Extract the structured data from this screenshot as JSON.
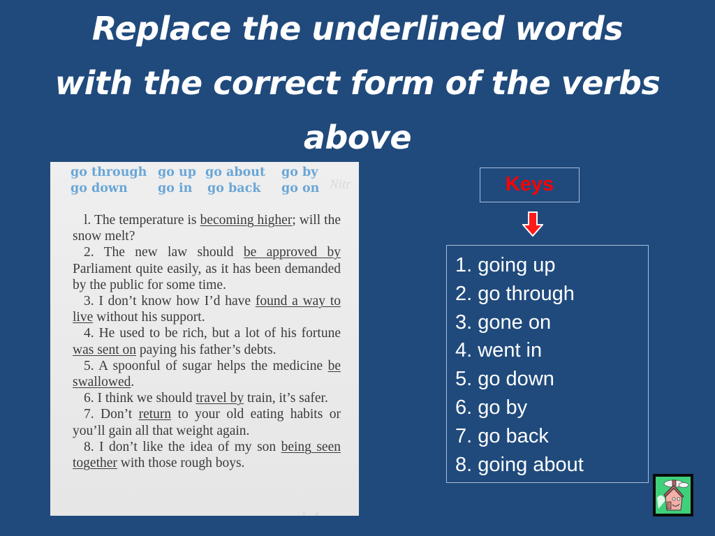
{
  "slide": {
    "title_lines": [
      "Replace the underlined words",
      "with the correct form of the verbs",
      "above"
    ]
  },
  "exercise_image": {
    "verb_rows": [
      [
        "go through",
        "go up",
        "go about",
        "go by"
      ],
      [
        "go down",
        "go in",
        "go back",
        "go on"
      ]
    ],
    "sentences": [
      {
        "before": "l. The temperature is ",
        "underlined": "becoming higher",
        "after": "; will the snow melt?"
      },
      {
        "before": "2. The new law should ",
        "underlined": "be approved by",
        "after": " Parliament quite easily, as it has been demanded by the public for some time."
      },
      {
        "before": "3. I don’t know how I’d have ",
        "underlined": "found a way to live",
        "after": " without his support."
      },
      {
        "before": "4. He used to be rich, but a lot of his for­tune ",
        "underlined": "was sent on",
        "after": " paying his father’s debts."
      },
      {
        "before": "5. A spoonful of sugar helps the medicine ",
        "underlined": "be swallowed",
        "after": "."
      },
      {
        "before": "6. I think we should ",
        "underlined": "travel by",
        "after": " train, it’s safer."
      },
      {
        "before": "7. Don’t ",
        "underlined": "return",
        "after": " to your old eating habits or you’ll gain all that weight again."
      },
      {
        "before": "8. I don’t like the idea of my son ",
        "underlined": "being seen together",
        "after": " with those rough boys."
      }
    ],
    "verb_color": "#6aa6d6",
    "text_color": "#3a3a3a"
  },
  "keys": {
    "label": "Keys",
    "label_color": "#ff0000",
    "arrow_icon": "down-arrow-icon",
    "answers": [
      "1. going up",
      "2. go through",
      "3. gone on",
      "4. went in",
      "5. go down",
      "6. go by",
      "7. go back",
      "8. going about"
    ]
  },
  "nav": {
    "home_icon": "house-icon"
  },
  "colors": {
    "background": "#204a7c",
    "box_border": "#a9bfdc",
    "text": "#ffffff"
  }
}
